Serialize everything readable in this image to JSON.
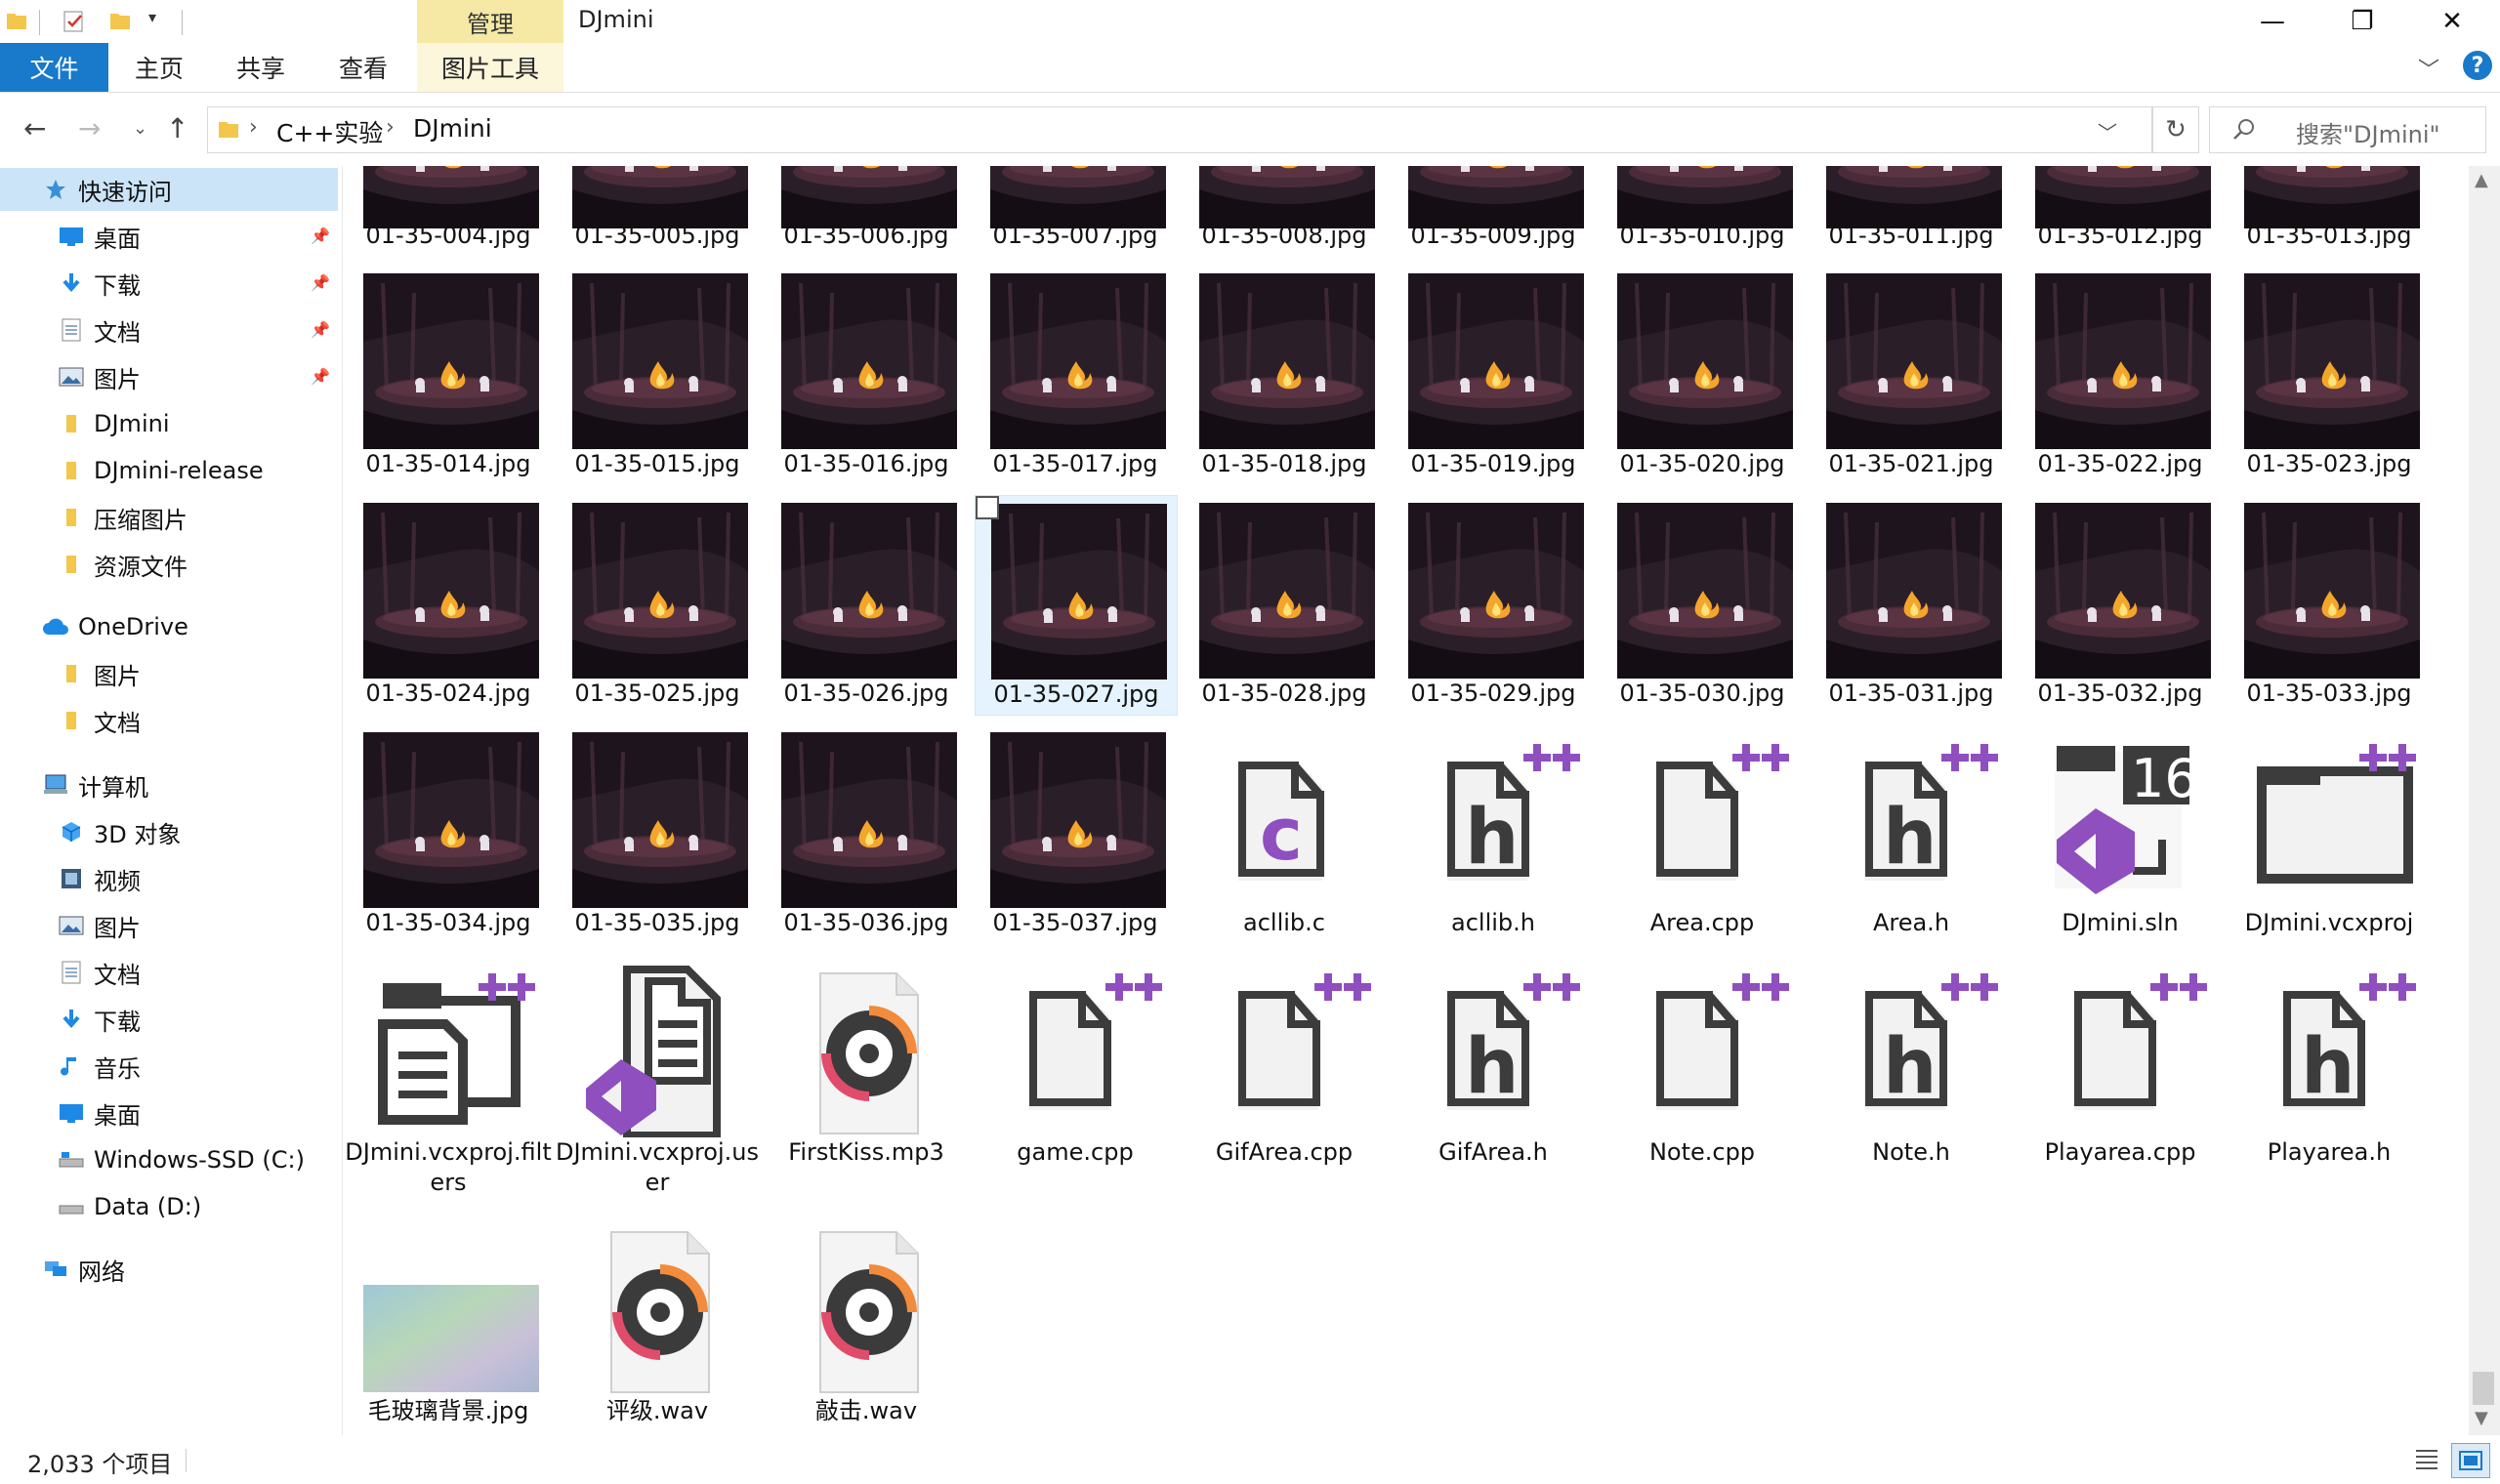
{
  "window": {
    "title": "DJmini",
    "manage_tab": "管理",
    "controls": {
      "minimize": "—",
      "maximize": "❐",
      "close": "✕"
    }
  },
  "ribbon": {
    "tabs": [
      {
        "label": "文件"
      },
      {
        "label": "主页"
      },
      {
        "label": "共享"
      },
      {
        "label": "查看"
      },
      {
        "label": "图片工具"
      }
    ],
    "help": "?"
  },
  "address": {
    "crumbs": [
      "C++实验",
      "DJmini"
    ],
    "search_placeholder": "搜索\"DJmini\""
  },
  "sidebar": {
    "items": [
      {
        "label": "快速访问",
        "icon": "star-icon"
      },
      {
        "label": "桌面",
        "icon": "desktop-icon",
        "pinned": true
      },
      {
        "label": "下载",
        "icon": "download-icon",
        "pinned": true
      },
      {
        "label": "文档",
        "icon": "document-icon",
        "pinned": true
      },
      {
        "label": "图片",
        "icon": "pictures-icon",
        "pinned": true
      },
      {
        "label": "DJmini",
        "icon": "folder-icon"
      },
      {
        "label": "DJmini-release",
        "icon": "folder-icon"
      },
      {
        "label": "压缩图片",
        "icon": "folder-icon"
      },
      {
        "label": "资源文件",
        "icon": "folder-icon"
      },
      {
        "label": "OneDrive",
        "icon": "cloud-icon"
      },
      {
        "label": "图片",
        "icon": "folder-icon"
      },
      {
        "label": "文档",
        "icon": "folder-icon"
      },
      {
        "label": "计算机",
        "icon": "computer-icon"
      },
      {
        "label": "3D 对象",
        "icon": "3d-objects-icon"
      },
      {
        "label": "视频",
        "icon": "video-icon"
      },
      {
        "label": "图片",
        "icon": "pictures-icon"
      },
      {
        "label": "文档",
        "icon": "document-icon"
      },
      {
        "label": "下载",
        "icon": "download-icon"
      },
      {
        "label": "音乐",
        "icon": "music-icon"
      },
      {
        "label": "桌面",
        "icon": "desktop-icon"
      },
      {
        "label": "Windows-SSD (C:)",
        "icon": "drive-c-icon"
      },
      {
        "label": "Data (D:)",
        "icon": "drive-d-icon"
      },
      {
        "label": "网络",
        "icon": "network-icon"
      }
    ]
  },
  "files": {
    "row0": [
      "01-35-004.jpg",
      "01-35-005.jpg",
      "01-35-006.jpg",
      "01-35-007.jpg",
      "01-35-008.jpg",
      "01-35-009.jpg",
      "01-35-010.jpg",
      "01-35-011.jpg",
      "01-35-012.jpg",
      "01-35-013.jpg"
    ],
    "row1": [
      "01-35-014.jpg",
      "01-35-015.jpg",
      "01-35-016.jpg",
      "01-35-017.jpg",
      "01-35-018.jpg",
      "01-35-019.jpg",
      "01-35-020.jpg",
      "01-35-021.jpg",
      "01-35-022.jpg",
      "01-35-023.jpg"
    ],
    "row2": [
      "01-35-024.jpg",
      "01-35-025.jpg",
      "01-35-026.jpg",
      "01-35-027.jpg",
      "01-35-028.jpg",
      "01-35-029.jpg",
      "01-35-030.jpg",
      "01-35-031.jpg",
      "01-35-032.jpg",
      "01-35-033.jpg"
    ],
    "row3": [
      {
        "name": "01-35-034.jpg",
        "type": "fire"
      },
      {
        "name": "01-35-035.jpg",
        "type": "fire"
      },
      {
        "name": "01-35-036.jpg",
        "type": "fire"
      },
      {
        "name": "01-35-037.jpg",
        "type": "fire"
      },
      {
        "name": "acllib.c",
        "type": "c"
      },
      {
        "name": "acllib.h",
        "type": "h"
      },
      {
        "name": "Area.cpp",
        "type": "cpp"
      },
      {
        "name": "Area.h",
        "type": "h"
      },
      {
        "name": "DJmini.sln",
        "type": "sln"
      },
      {
        "name": "DJmini.vcxproj",
        "type": "vcxproj"
      }
    ],
    "row4": [
      {
        "name": "DJmini.vcxproj.filters",
        "type": "filters"
      },
      {
        "name": "DJmini.vcxproj.user",
        "type": "user"
      },
      {
        "name": "FirstKiss.mp3",
        "type": "audio"
      },
      {
        "name": "game.cpp",
        "type": "cpp"
      },
      {
        "name": "GifArea.cpp",
        "type": "cpp"
      },
      {
        "name": "GifArea.h",
        "type": "h"
      },
      {
        "name": "Note.cpp",
        "type": "cpp"
      },
      {
        "name": "Note.h",
        "type": "h"
      },
      {
        "name": "Playarea.cpp",
        "type": "cpp"
      },
      {
        "name": "Playarea.h",
        "type": "h"
      }
    ],
    "row5": [
      {
        "name": "毛玻璃背景.jpg",
        "type": "blur"
      },
      {
        "name": "评级.wav",
        "type": "audio"
      },
      {
        "name": "敲击.wav",
        "type": "audio"
      }
    ],
    "selected": "01-35-027.jpg",
    "sln_version": "16"
  },
  "status": {
    "count": "2,033 个项目"
  },
  "colors": {
    "accent": "#1979ca",
    "vs_purple": "#8f4fbf",
    "manage_tab": "#f6e9a6",
    "selection": "#cce4f7"
  }
}
